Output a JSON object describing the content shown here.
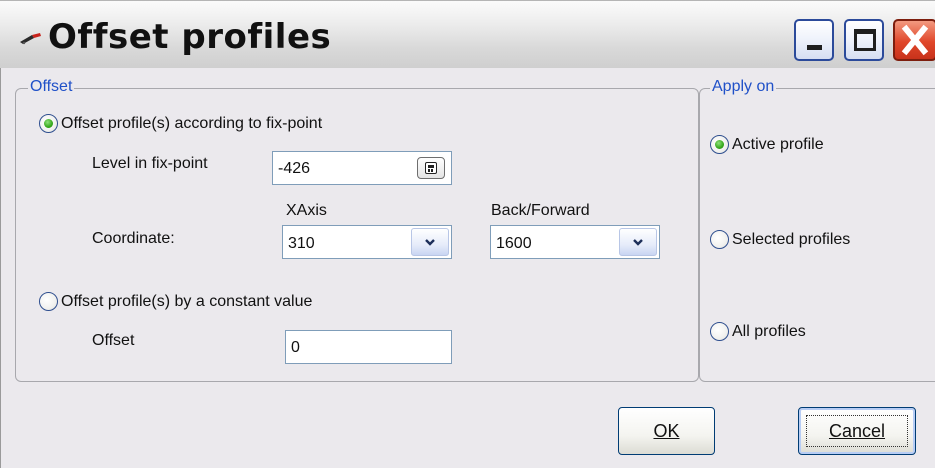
{
  "window": {
    "title": "Offset profiles",
    "icons": {
      "app": "app-icon",
      "minimize": "minimize-icon",
      "maximize": "maximize-icon",
      "close": "close-icon"
    }
  },
  "offset_group": {
    "legend": "Offset",
    "option_fixpoint": {
      "label": "Offset profile(s) according to fix-point",
      "checked": true
    },
    "level_label": "Level in fix-point",
    "level_value": "-426",
    "coordinate_label": "Coordinate:",
    "xaxis_header": "XAxis",
    "xaxis_value": "310",
    "backforward_header": "Back/Forward",
    "backforward_value": "1600",
    "option_constant": {
      "label": "Offset profile(s) by a constant value",
      "checked": false
    },
    "offset_label": "Offset",
    "offset_value": "0"
  },
  "apply_group": {
    "legend": "Apply on",
    "options": [
      {
        "label": "Active profile",
        "checked": true
      },
      {
        "label": "Selected profiles",
        "checked": false
      },
      {
        "label": "All profiles",
        "checked": false
      }
    ]
  },
  "buttons": {
    "ok_label": "OK",
    "cancel_label": "Cancel"
  }
}
